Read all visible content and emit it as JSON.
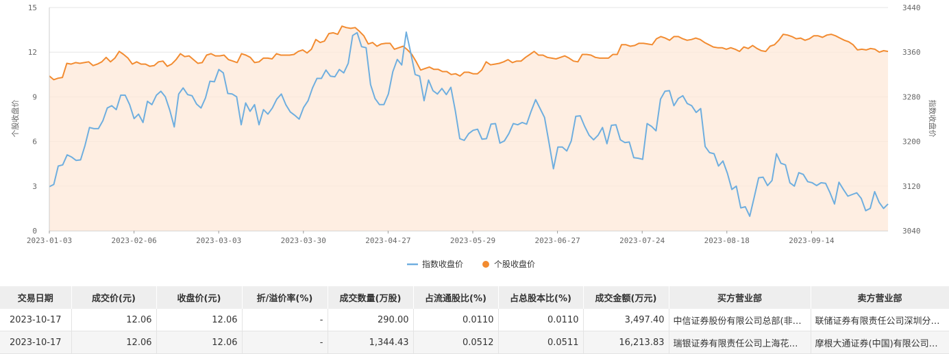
{
  "chart_data": {
    "type": "line",
    "x_ticks": [
      "2023-01-03",
      "2023-02-06",
      "2023-03-03",
      "2023-03-30",
      "2023-04-27",
      "2023-05-29",
      "2023-06-27",
      "2023-07-24",
      "2023-08-18",
      "2023-09-14"
    ],
    "left_axis": {
      "title": "个股收盘价",
      "ticks": [
        0,
        3,
        6,
        9,
        12,
        15
      ],
      "range": [
        0,
        15
      ]
    },
    "right_axis": {
      "title": "指数收盘价",
      "ticks": [
        3040,
        3120,
        3200,
        3280,
        3360,
        3440
      ],
      "range": [
        3040,
        3440
      ]
    },
    "grid": true,
    "legend_position": "bottom-center",
    "series": [
      {
        "name": "指数收盘价",
        "axis": "right",
        "color": "#6eaedf",
        "values": [
          3119,
          3123,
          3156,
          3158,
          3176,
          3172,
          3166,
          3167,
          3193,
          3225,
          3223,
          3223,
          3237,
          3260,
          3264,
          3257,
          3283,
          3283,
          3266,
          3241,
          3249,
          3234,
          3272,
          3266,
          3283,
          3290,
          3280,
          3256,
          3226,
          3285,
          3296,
          3284,
          3282,
          3267,
          3260,
          3278,
          3308,
          3307,
          3329,
          3323,
          3286,
          3285,
          3280,
          3230,
          3269,
          3254,
          3266,
          3230,
          3257,
          3249,
          3260,
          3276,
          3285,
          3266,
          3253,
          3247,
          3240,
          3261,
          3273,
          3296,
          3313,
          3313,
          3328,
          3317,
          3316,
          3329,
          3323,
          3340,
          3390,
          3395,
          3370,
          3368,
          3302,
          3277,
          3266,
          3266,
          3285,
          3325,
          3347,
          3337,
          3396,
          3359,
          3320,
          3317,
          3273,
          3310,
          3291,
          3285,
          3295,
          3284,
          3297,
          3255,
          3205,
          3202,
          3214,
          3220,
          3222,
          3204,
          3205,
          3231,
          3232,
          3197,
          3201,
          3214,
          3232,
          3230,
          3234,
          3231,
          3254,
          3275,
          3259,
          3243,
          3198,
          3151,
          3190,
          3190,
          3183,
          3201,
          3245,
          3246,
          3227,
          3211,
          3203,
          3211,
          3225,
          3196,
          3229,
          3230,
          3203,
          3198,
          3199,
          3171,
          3170,
          3168,
          3232,
          3227,
          3219,
          3276,
          3290,
          3291,
          3264,
          3277,
          3282,
          3268,
          3264,
          3252,
          3259,
          3191,
          3180,
          3178,
          3156,
          3165,
          3143,
          3114,
          3120,
          3081,
          3083,
          3066,
          3100,
          3135,
          3136,
          3121,
          3130,
          3178,
          3161,
          3158,
          3126,
          3120,
          3144,
          3141,
          3128,
          3126,
          3121,
          3126,
          3125,
          3108,
          3088,
          3127,
          3114,
          3102,
          3105,
          3108,
          3098,
          3076,
          3080,
          3110,
          3091,
          3080,
          3088
        ]
      },
      {
        "name": "个股收盘价",
        "axis": "left",
        "color": "#f28b30",
        "values": [
          10.4,
          10.15,
          10.25,
          10.3,
          11.25,
          11.2,
          11.3,
          11.25,
          11.3,
          11.35,
          11.1,
          11.2,
          11.35,
          11.65,
          11.35,
          11.6,
          12.05,
          11.85,
          11.6,
          11.2,
          11.35,
          11.2,
          11.2,
          11.05,
          11.1,
          11.35,
          11.4,
          11.05,
          11.2,
          11.5,
          11.9,
          11.7,
          11.75,
          11.5,
          11.25,
          11.3,
          11.8,
          11.9,
          11.75,
          11.75,
          11.8,
          11.5,
          11.4,
          11.3,
          11.9,
          11.8,
          11.65,
          11.3,
          11.35,
          11.6,
          11.6,
          11.55,
          11.9,
          11.8,
          11.8,
          11.8,
          11.85,
          12.05,
          12.15,
          11.95,
          12.2,
          12.85,
          12.65,
          12.75,
          13.25,
          13.3,
          13.2,
          13.75,
          13.65,
          13.6,
          13.65,
          13.4,
          13.1,
          12.55,
          12.65,
          12.4,
          12.55,
          12.6,
          12.6,
          12.2,
          12.3,
          12.4,
          12.15,
          11.85,
          11.35,
          10.8,
          10.9,
          11.0,
          10.85,
          10.85,
          10.7,
          10.7,
          10.5,
          10.55,
          10.4,
          10.65,
          10.65,
          10.55,
          10.55,
          10.8,
          11.35,
          11.15,
          11.2,
          11.25,
          11.35,
          11.5,
          11.3,
          11.4,
          11.4,
          11.65,
          11.85,
          12.05,
          11.8,
          11.8,
          11.65,
          11.6,
          11.55,
          11.65,
          11.75,
          11.6,
          11.4,
          11.35,
          11.85,
          11.85,
          11.8,
          11.65,
          11.6,
          11.6,
          11.6,
          11.85,
          11.85,
          12.5,
          12.5,
          12.4,
          12.45,
          12.6,
          12.6,
          12.55,
          12.5,
          12.9,
          13.05,
          12.95,
          12.8,
          13.05,
          13.05,
          12.9,
          12.8,
          12.85,
          12.95,
          12.85,
          12.65,
          12.5,
          12.35,
          12.3,
          12.3,
          12.2,
          12.3,
          12.2,
          12.05,
          12.35,
          12.25,
          12.45,
          12.25,
          12.1,
          12.05,
          12.4,
          12.5,
          12.8,
          13.2,
          13.15,
          13.05,
          12.9,
          12.95,
          12.8,
          12.9,
          13.1,
          13.1,
          13.0,
          13.15,
          13.2,
          13.1,
          12.95,
          12.8,
          12.7,
          12.5,
          12.15,
          12.2,
          12.15,
          12.25,
          12.2,
          12.0,
          12.1,
          12.05
        ]
      }
    ]
  },
  "table": {
    "headers": [
      "交易日期",
      "成交价(元)",
      "收盘价(元)",
      "折/溢价率(%)",
      "成交数量(万股)",
      "占流通股比(%)",
      "占总股本比(%)",
      "成交金额(万元)",
      "买方营业部",
      "卖方营业部"
    ],
    "rows": [
      [
        "2023-10-17",
        "12.06",
        "12.06",
        "-",
        "290.00",
        "0.0110",
        "0.0110",
        "3,497.40",
        "中信证券股份有限公司总部(非营业场所)",
        "联储证券有限责任公司深圳分公司"
      ],
      [
        "2023-10-17",
        "12.06",
        "12.06",
        "-",
        "1,344.43",
        "0.0512",
        "0.0511",
        "16,213.83",
        "瑞银证券有限责任公司上海花园石桥路证券营业部",
        "摩根大通证券(中国)有限公司上海银城中路证券营业部"
      ]
    ]
  }
}
